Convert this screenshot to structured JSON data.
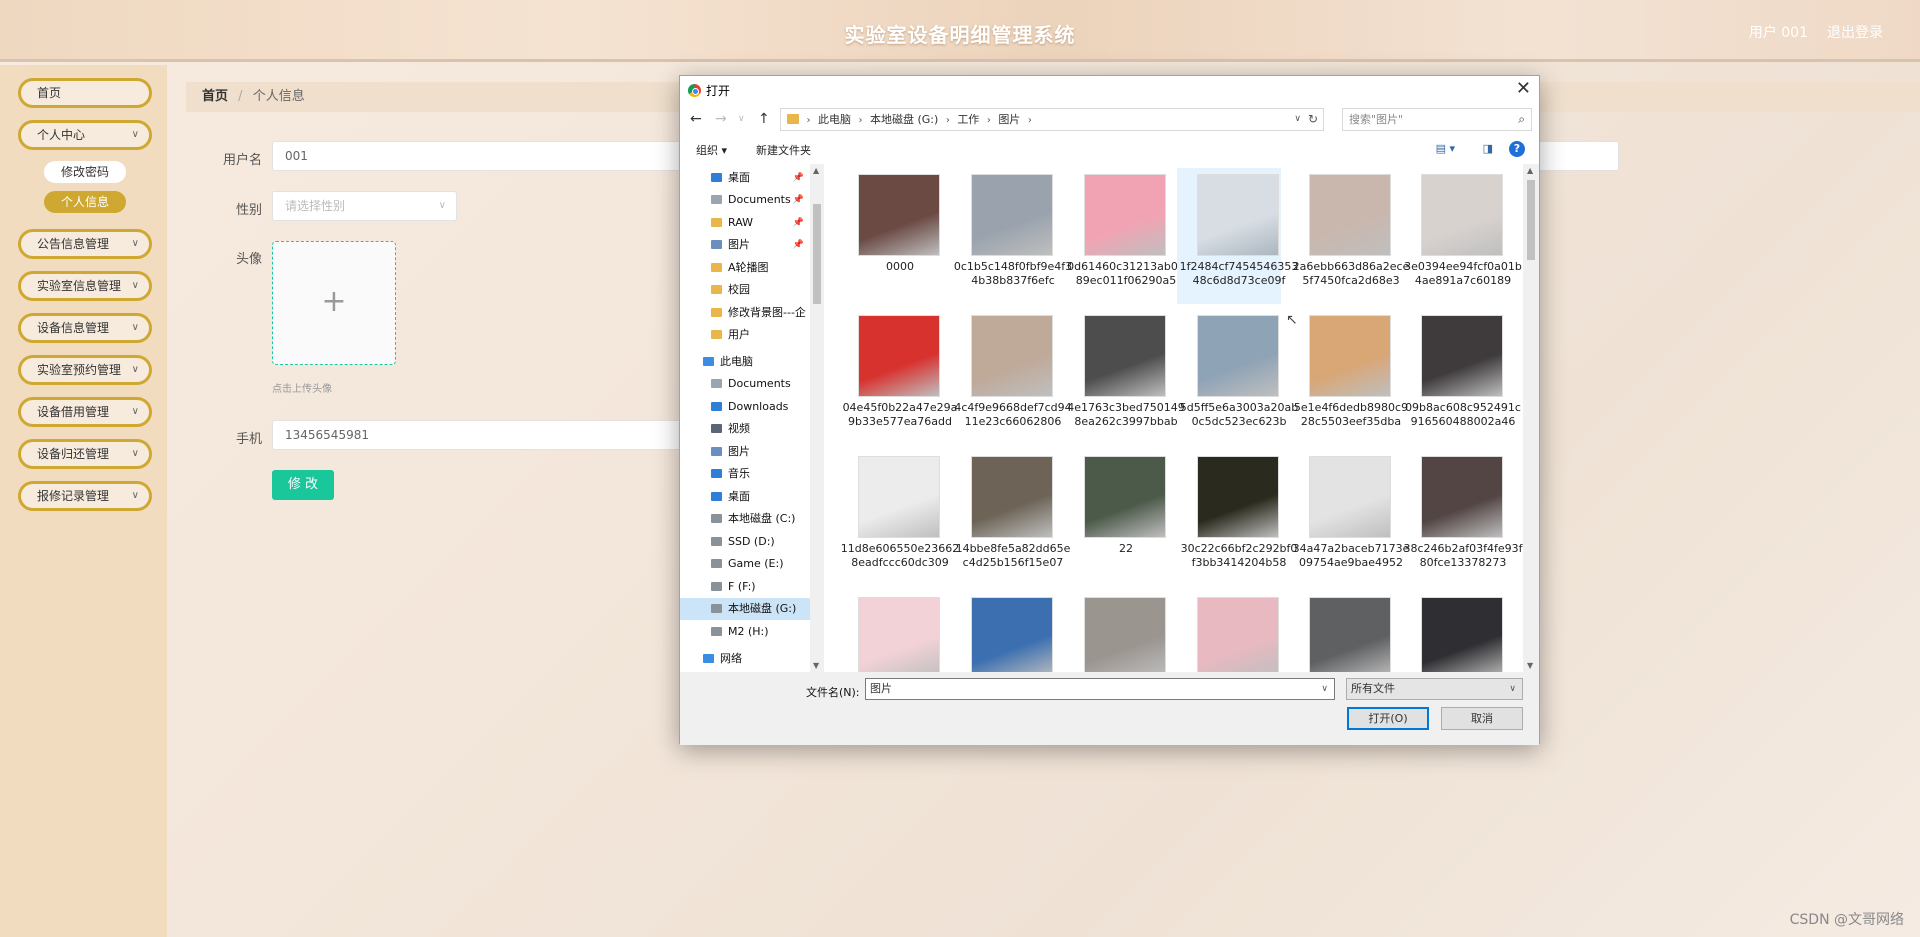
{
  "header": {
    "title": "实验室设备明细管理系统",
    "user": "用户 001",
    "logout": "退出登录"
  },
  "sidebar": {
    "items": [
      {
        "label": "首页",
        "chev": ""
      },
      {
        "label": "个人中心",
        "chev": "∨"
      },
      {
        "label": "公告信息管理",
        "chev": "∨"
      },
      {
        "label": "实验室信息管理",
        "chev": "∨"
      },
      {
        "label": "设备信息管理",
        "chev": "∨"
      },
      {
        "label": "实验室预约管理",
        "chev": "∨"
      },
      {
        "label": "设备借用管理",
        "chev": "∨"
      },
      {
        "label": "设备归还管理",
        "chev": "∨"
      },
      {
        "label": "报修记录管理",
        "chev": "∨"
      }
    ],
    "sub_items": [
      {
        "label": "修改密码",
        "active": false
      },
      {
        "label": "个人信息",
        "active": true
      }
    ]
  },
  "breadcrumb": {
    "home": "首页",
    "sep": "/",
    "current": "个人信息"
  },
  "form": {
    "username_label": "用户名",
    "username_value": "001",
    "gender_label": "性别",
    "gender_placeholder": "请选择性别",
    "avatar_label": "头像",
    "upload_plus": "+",
    "upload_tip": "点击上传头像",
    "phone_label": "手机",
    "phone_value": "13456545981",
    "submit_label": "修 改"
  },
  "watermark": "CSDN @文哥网络",
  "dialog": {
    "title": "打开",
    "close": "✕",
    "address": {
      "crumbs": [
        "此电脑",
        "本地磁盘 (G:)",
        "工作",
        "图片"
      ]
    },
    "search_placeholder": "搜索\"图片\"",
    "toolbar": {
      "organize": "组织 ▾",
      "new_folder": "新建文件夹",
      "help": "?"
    },
    "nav_items": [
      {
        "label": "桌面",
        "pinned": true,
        "level": 1,
        "icon_color": "#2f7fd8",
        "selected": false
      },
      {
        "label": "Documents",
        "pinned": true,
        "level": 1,
        "icon_color": "#9aa5b1",
        "selected": false
      },
      {
        "label": "RAW",
        "pinned": true,
        "level": 1,
        "icon_color": "#e8b64a",
        "selected": false
      },
      {
        "label": "图片",
        "pinned": true,
        "level": 1,
        "icon_color": "#6a8fbf",
        "selected": false
      },
      {
        "label": "A轮播图",
        "pinned": false,
        "level": 1,
        "icon_color": "#e8b64a",
        "selected": false
      },
      {
        "label": "校园",
        "pinned": false,
        "level": 1,
        "icon_color": "#e8b64a",
        "selected": false
      },
      {
        "label": "修改背景图---企",
        "pinned": false,
        "level": 1,
        "icon_color": "#e8b64a",
        "selected": false
      },
      {
        "label": "用户",
        "pinned": false,
        "level": 1,
        "icon_color": "#e8b64a",
        "selected": false
      },
      {
        "label": "此电脑",
        "pinned": false,
        "level": 0,
        "icon_color": "#3a8de0",
        "selected": false
      },
      {
        "label": "Documents",
        "pinned": false,
        "level": 1,
        "icon_color": "#9aa5b1",
        "selected": false
      },
      {
        "label": "Downloads",
        "pinned": false,
        "level": 1,
        "icon_color": "#2f7fd8",
        "selected": false
      },
      {
        "label": "视频",
        "pinned": false,
        "level": 1,
        "icon_color": "#5a6675",
        "selected": false
      },
      {
        "label": "图片",
        "pinned": false,
        "level": 1,
        "icon_color": "#6a8fbf",
        "selected": false
      },
      {
        "label": "音乐",
        "pinned": false,
        "level": 1,
        "icon_color": "#2f7fd8",
        "selected": false
      },
      {
        "label": "桌面",
        "pinned": false,
        "level": 1,
        "icon_color": "#2f7fd8",
        "selected": false
      },
      {
        "label": "本地磁盘 (C:)",
        "pinned": false,
        "level": 1,
        "icon_color": "#8a9299",
        "selected": false
      },
      {
        "label": "SSD (D:)",
        "pinned": false,
        "level": 1,
        "icon_color": "#8a9299",
        "selected": false
      },
      {
        "label": "Game (E:)",
        "pinned": false,
        "level": 1,
        "icon_color": "#8a9299",
        "selected": false
      },
      {
        "label": "F (F:)",
        "pinned": false,
        "level": 1,
        "icon_color": "#8a9299",
        "selected": false
      },
      {
        "label": "本地磁盘 (G:)",
        "pinned": false,
        "level": 1,
        "icon_color": "#8a9299",
        "selected": true
      },
      {
        "label": "M2 (H:)",
        "pinned": false,
        "level": 1,
        "icon_color": "#8a9299",
        "selected": false
      },
      {
        "label": "网络",
        "pinned": false,
        "level": 0,
        "icon_color": "#3a8de0",
        "selected": false
      }
    ],
    "files": [
      {
        "name": "0000",
        "color": "#6b4a44"
      },
      {
        "name": "0c1b5c148f0fbf9e4f34b38b837f6efc",
        "color": "#9aa3ad"
      },
      {
        "name": "0d61460c31213ab0389ec011f06290a5",
        "color": "#f2a3b3"
      },
      {
        "name": "1f2484cf745454635348c6d8d73ce09f",
        "color": "#d7dde3",
        "hover": true
      },
      {
        "name": "2a6ebb663d86a2ece5f7450fca2d68e3",
        "color": "#c9b7ae"
      },
      {
        "name": "3e0394ee94fcf0a01b4ae891a7c60189",
        "color": "#d8d2cf"
      },
      {
        "name": "04e45f0b22a47e29a9b33e577ea76add",
        "color": "#d8322f"
      },
      {
        "name": "4c4f9e9668def7cd9411e23c66062806",
        "color": "#bfa999"
      },
      {
        "name": "4e1763c3bed7501498ea262c3997bbab",
        "color": "#4d4d4d"
      },
      {
        "name": "5d5ff5e6a3003a20ab0c5dc523ec623b",
        "color": "#8fa3b6"
      },
      {
        "name": "5e1e4f6dedb8980c928c5503eef35dba",
        "color": "#d9a676"
      },
      {
        "name": "09b8ac608c952491c916560488002a46",
        "color": "#3f3b3d"
      },
      {
        "name": "11d8e606550e236628eadfccc60dc309",
        "color": "#ececec"
      },
      {
        "name": "14bbe8fe5a82dd65ec4d25b156f15e07",
        "color": "#6d6457"
      },
      {
        "name": "22",
        "color": "#4c5a4a"
      },
      {
        "name": "30c22c66bf2c292bf0f3bb3414204b58",
        "color": "#2b2a1e"
      },
      {
        "name": "34a47a2baceb7173e09754ae9bae4952",
        "color": "#e3e3e3"
      },
      {
        "name": "38c246b2af03f4fe93f80fce13378273",
        "color": "#524544"
      },
      {
        "name": "",
        "color": "#f3d2d7"
      },
      {
        "name": "",
        "color": "#3b6fb0"
      },
      {
        "name": "",
        "color": "#9b9590"
      },
      {
        "name": "",
        "color": "#e8b9c1"
      },
      {
        "name": "",
        "color": "#5f6062"
      },
      {
        "name": "",
        "color": "#2f2f33"
      }
    ],
    "filename_label": "文件名(N):",
    "filename_value": "图片",
    "filetype_value": "所有文件",
    "open_label": "打开(O)",
    "cancel_label": "取消"
  }
}
